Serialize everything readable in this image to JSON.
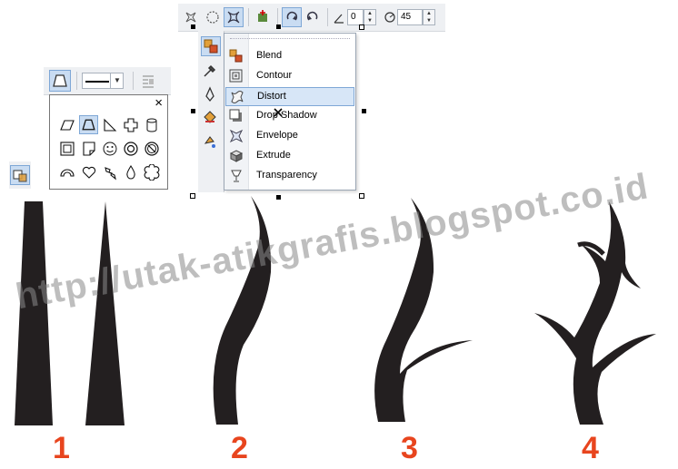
{
  "property_bar": {
    "spin1_value": "0",
    "spin2_value": "45"
  },
  "effects_menu": {
    "items": [
      {
        "label": "Blend",
        "icon": "blend-icon"
      },
      {
        "label": "Contour",
        "icon": "contour-icon"
      },
      {
        "label": "Distort",
        "icon": "distort-icon",
        "highlighted": true
      },
      {
        "label": "Drop Shadow",
        "icon": "drop-shadow-icon"
      },
      {
        "label": "Envelope",
        "icon": "envelope-icon"
      },
      {
        "label": "Extrude",
        "icon": "extrude-icon"
      },
      {
        "label": "Transparency",
        "icon": "transparency-icon"
      }
    ]
  },
  "shape_panel": {
    "close": "×"
  },
  "watermark": "http://utak-atikgrafis.blogspot.co.id",
  "steps": [
    "1",
    "2",
    "3",
    "4"
  ],
  "colors": {
    "accent": "#e8451e",
    "shape_fill": "#231f20",
    "highlight": "#c9dcf2"
  }
}
